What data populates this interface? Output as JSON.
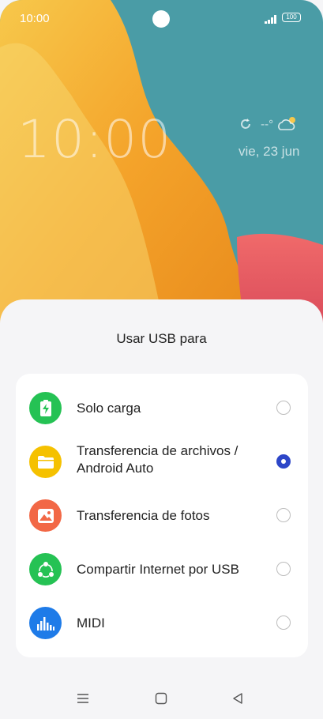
{
  "status_bar": {
    "time": "10:00",
    "battery": "100"
  },
  "lockscreen": {
    "clock": "10:00",
    "weather_temp": "--°",
    "date": "vie, 23 jun"
  },
  "dialog": {
    "title": "Usar USB para",
    "options": [
      {
        "label": "Solo carga",
        "icon": "battery-charge-icon",
        "color": "#25c254",
        "selected": false
      },
      {
        "label_line1": "Transferencia de archivos /",
        "label_line2": "Android Auto",
        "icon": "folder-icon",
        "color": "#f5c100",
        "selected": true
      },
      {
        "label": "Transferencia de fotos",
        "icon": "photo-icon",
        "color": "#f26846",
        "selected": false
      },
      {
        "label": "Compartir Internet por USB",
        "icon": "share-icon",
        "color": "#25c254",
        "selected": false
      },
      {
        "label": "MIDI",
        "icon": "equalizer-icon",
        "color": "#1e7be8",
        "selected": false
      }
    ]
  },
  "colors": {
    "accent": "#2d46c8",
    "wallpaper_teal": "#4a9ca6",
    "wallpaper_orange": "#f4a32a"
  }
}
